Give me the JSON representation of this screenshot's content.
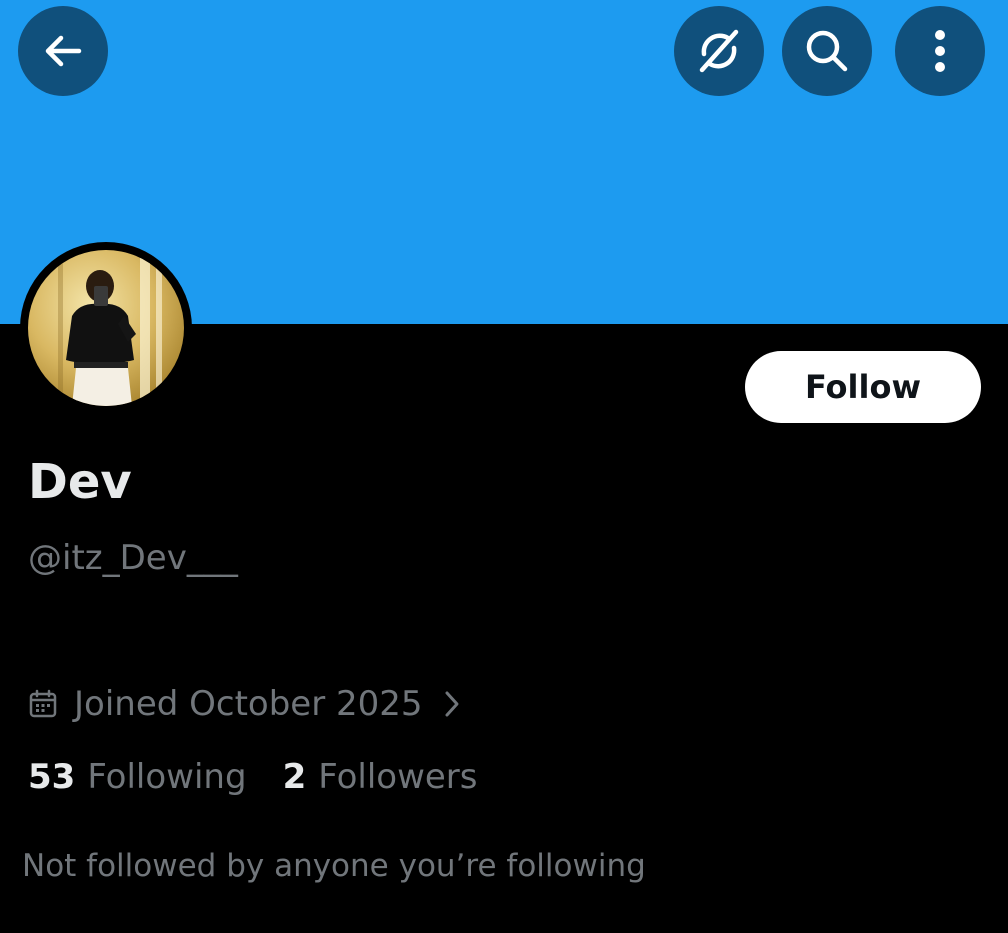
{
  "profile": {
    "display_name": "Dev",
    "handle": "@itz_Dev___",
    "joined": "Joined October 2025",
    "follow_label": "Follow",
    "following_count": "53",
    "following_label": "Following",
    "followers_count": "2",
    "followers_label": "Followers",
    "mutuals_note": "Not followed by anyone you’re following"
  },
  "header": {
    "icons": [
      "back-arrow-icon",
      "grok-icon",
      "search-icon",
      "more-vertical-icon"
    ]
  },
  "colors": {
    "banner": "#1d9bf0",
    "icon_button_bg": "#10507c",
    "background": "#000000",
    "primary_text": "#e7e9ea",
    "secondary_text": "#71767b",
    "follow_button_bg": "#ffffff"
  }
}
